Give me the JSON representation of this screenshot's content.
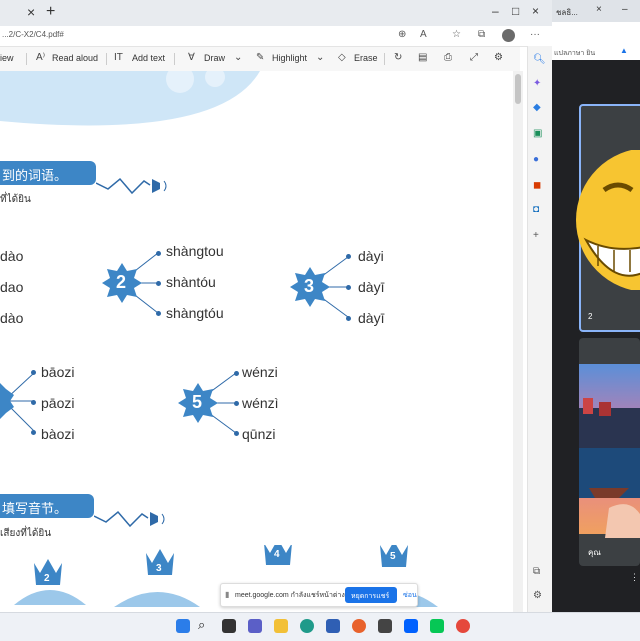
{
  "browser": {
    "tab_close_icon": "×",
    "new_tab_icon": "+",
    "url": "...2/C-X2/C4.pdf#",
    "minimize": "–",
    "maximize": "□",
    "close": "×"
  },
  "pdf_toolbar": {
    "view": "iew",
    "read_aloud": "Read aloud",
    "add_text": "Add text",
    "draw": "Draw",
    "highlight": "Highlight",
    "erase": "Erase"
  },
  "pdf": {
    "section1_title": "到的词语。",
    "section1_sub": "ที่ได้ยิน",
    "group1": [
      "dào",
      "dao",
      "dào"
    ],
    "group2": {
      "number": "2",
      "words": [
        "shàngtou",
        "shàntóu",
        "shàngtóu"
      ]
    },
    "group3": {
      "number": "3",
      "words": [
        "dàyi",
        "dàyī",
        "dàyī"
      ]
    },
    "group4": {
      "number": "4",
      "words": [
        "bāozi",
        "pāozi",
        "bàozi"
      ]
    },
    "group5": {
      "number": "5",
      "words": [
        "wénzi",
        "wénzì",
        "qūnzi"
      ]
    },
    "section2_title": "填写音节。",
    "section2_sub": "เสียงที่ได้ยิน",
    "crowns": [
      "2",
      "3",
      "4",
      "5"
    ]
  },
  "meet": {
    "tab_title": "คุณ",
    "tab_title2": "ชลธิ...",
    "address_text": "แปลภาษา ยิน",
    "tile_label": "คุณ",
    "tile_number": "2"
  },
  "notification": {
    "text": "meet.google.com กำลังแชร์หน้าต่าง",
    "stop_button": "หยุดการแชร์",
    "hide_button": "ซ่อน"
  },
  "colors": {
    "accent": "#3d86c6",
    "meet_bg": "#202124",
    "stop_button": "#1a73e8"
  }
}
